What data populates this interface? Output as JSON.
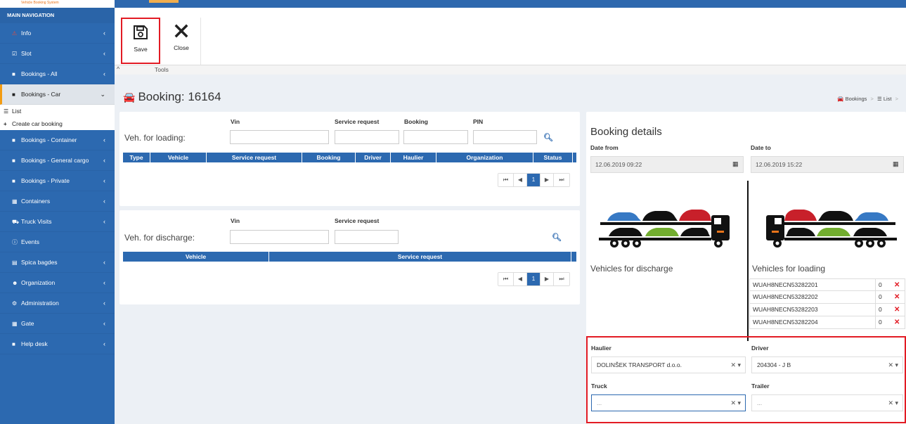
{
  "app": {
    "logo_text": "Vehicle Booking System"
  },
  "sidebar": {
    "header": "MAIN NAVIGATION",
    "items": [
      {
        "label": "Info",
        "icon": "warning-icon"
      },
      {
        "label": "Slot",
        "icon": "calendar-check-icon"
      },
      {
        "label": "Bookings - All",
        "icon": "folder-icon"
      },
      {
        "label": "Bookings - Car",
        "icon": "folder-icon"
      },
      {
        "label": "Bookings - Container",
        "icon": "folder-icon"
      },
      {
        "label": "Bookings - General cargo",
        "icon": "folder-icon"
      },
      {
        "label": "Bookings - Private",
        "icon": "folder-icon"
      },
      {
        "label": "Containers",
        "icon": "grid-icon"
      },
      {
        "label": "Truck Visits",
        "icon": "truck-icon"
      },
      {
        "label": "Events",
        "icon": "info-circle-icon"
      },
      {
        "label": "Spica bagdes",
        "icon": "id-card-icon"
      },
      {
        "label": "Organization",
        "icon": "users-icon"
      },
      {
        "label": "Administration",
        "icon": "cogs-icon"
      },
      {
        "label": "Gate",
        "icon": "grid-icon"
      },
      {
        "label": "Help desk",
        "icon": "folder-icon"
      }
    ],
    "submenu": [
      {
        "label": "List",
        "icon": "list-icon"
      },
      {
        "label": "Create car booking",
        "icon": "plus-icon"
      }
    ]
  },
  "toolbar": {
    "save_label": "Save",
    "close_label": "Close",
    "group_label": "Tools"
  },
  "page": {
    "title": "Booking: 16164",
    "breadcrumb": [
      "Bookings",
      "List"
    ]
  },
  "loading": {
    "row_label": "Veh. for loading:",
    "fields": [
      "Vin",
      "Service request",
      "Booking",
      "PIN"
    ],
    "columns": [
      "Type",
      "Vehicle",
      "Service request",
      "Booking",
      "Driver",
      "Haulier",
      "Organization",
      "Status"
    ],
    "pager": {
      "first": "⏮",
      "prev": "◀",
      "current": "1",
      "next": "▶",
      "last": "⏭"
    }
  },
  "discharge": {
    "row_label": "Veh. for discharge:",
    "fields": [
      "Vin",
      "Service request"
    ],
    "columns": [
      "Vehicle",
      "Service request"
    ],
    "pager": {
      "first": "⏮",
      "prev": "◀",
      "current": "1",
      "next": "▶",
      "last": "⏭"
    }
  },
  "details": {
    "title": "Booking details",
    "date_from_label": "Date from",
    "date_from_value": "12.06.2019 09:22",
    "date_to_label": "Date to",
    "date_to_value": "12.06.2019 15:22",
    "discharge_title": "Vehicles for discharge",
    "loading_title": "Vehicles for loading",
    "loading_vehicles": [
      {
        "vin": "WUAH8NECN53282201",
        "count": "0"
      },
      {
        "vin": "WUAH8NECN53282202",
        "count": "0"
      },
      {
        "vin": "WUAH8NECN53282203",
        "count": "0"
      },
      {
        "vin": "WUAH8NECN53282204",
        "count": "0"
      }
    ],
    "haulier_label": "Haulier",
    "haulier_value": "DOLINŠEK TRANSPORT d.o.o.",
    "driver_label": "Driver",
    "driver_value": "204304 - J B",
    "truck_label": "Truck",
    "truck_value": "...",
    "trailer_label": "Trailer",
    "trailer_value": "..."
  },
  "colors": {
    "primary": "#2c69b0",
    "highlight": "#e21b24",
    "accent": "#f39c12"
  }
}
